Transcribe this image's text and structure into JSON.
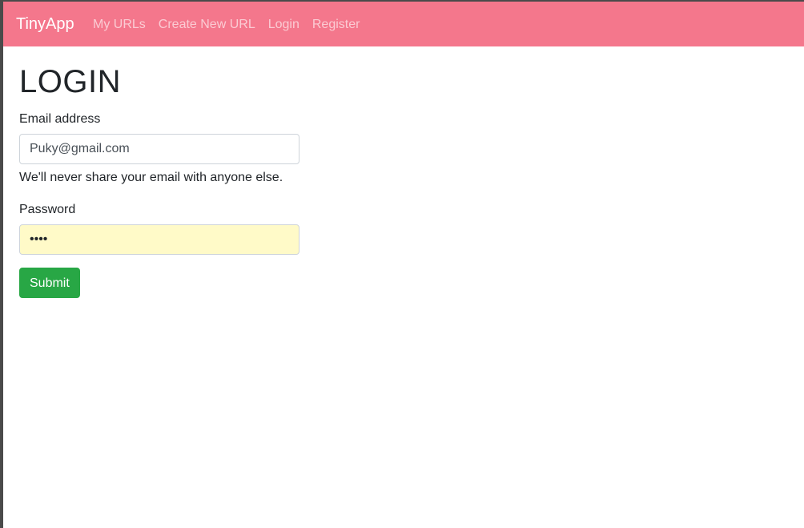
{
  "navbar": {
    "brand": "TinyApp",
    "links": [
      "My URLs",
      "Create New URL",
      "Login",
      "Register"
    ],
    "background_color": "#f4778c"
  },
  "login_form": {
    "title": "LOGIN",
    "email_label": "Email address",
    "email_value": "Puky@gmail.com",
    "email_help": "We'll never share your email with anyone else.",
    "password_label": "Password",
    "password_value": "••••",
    "submit_label": "Submit",
    "submit_color": "#28a745"
  }
}
